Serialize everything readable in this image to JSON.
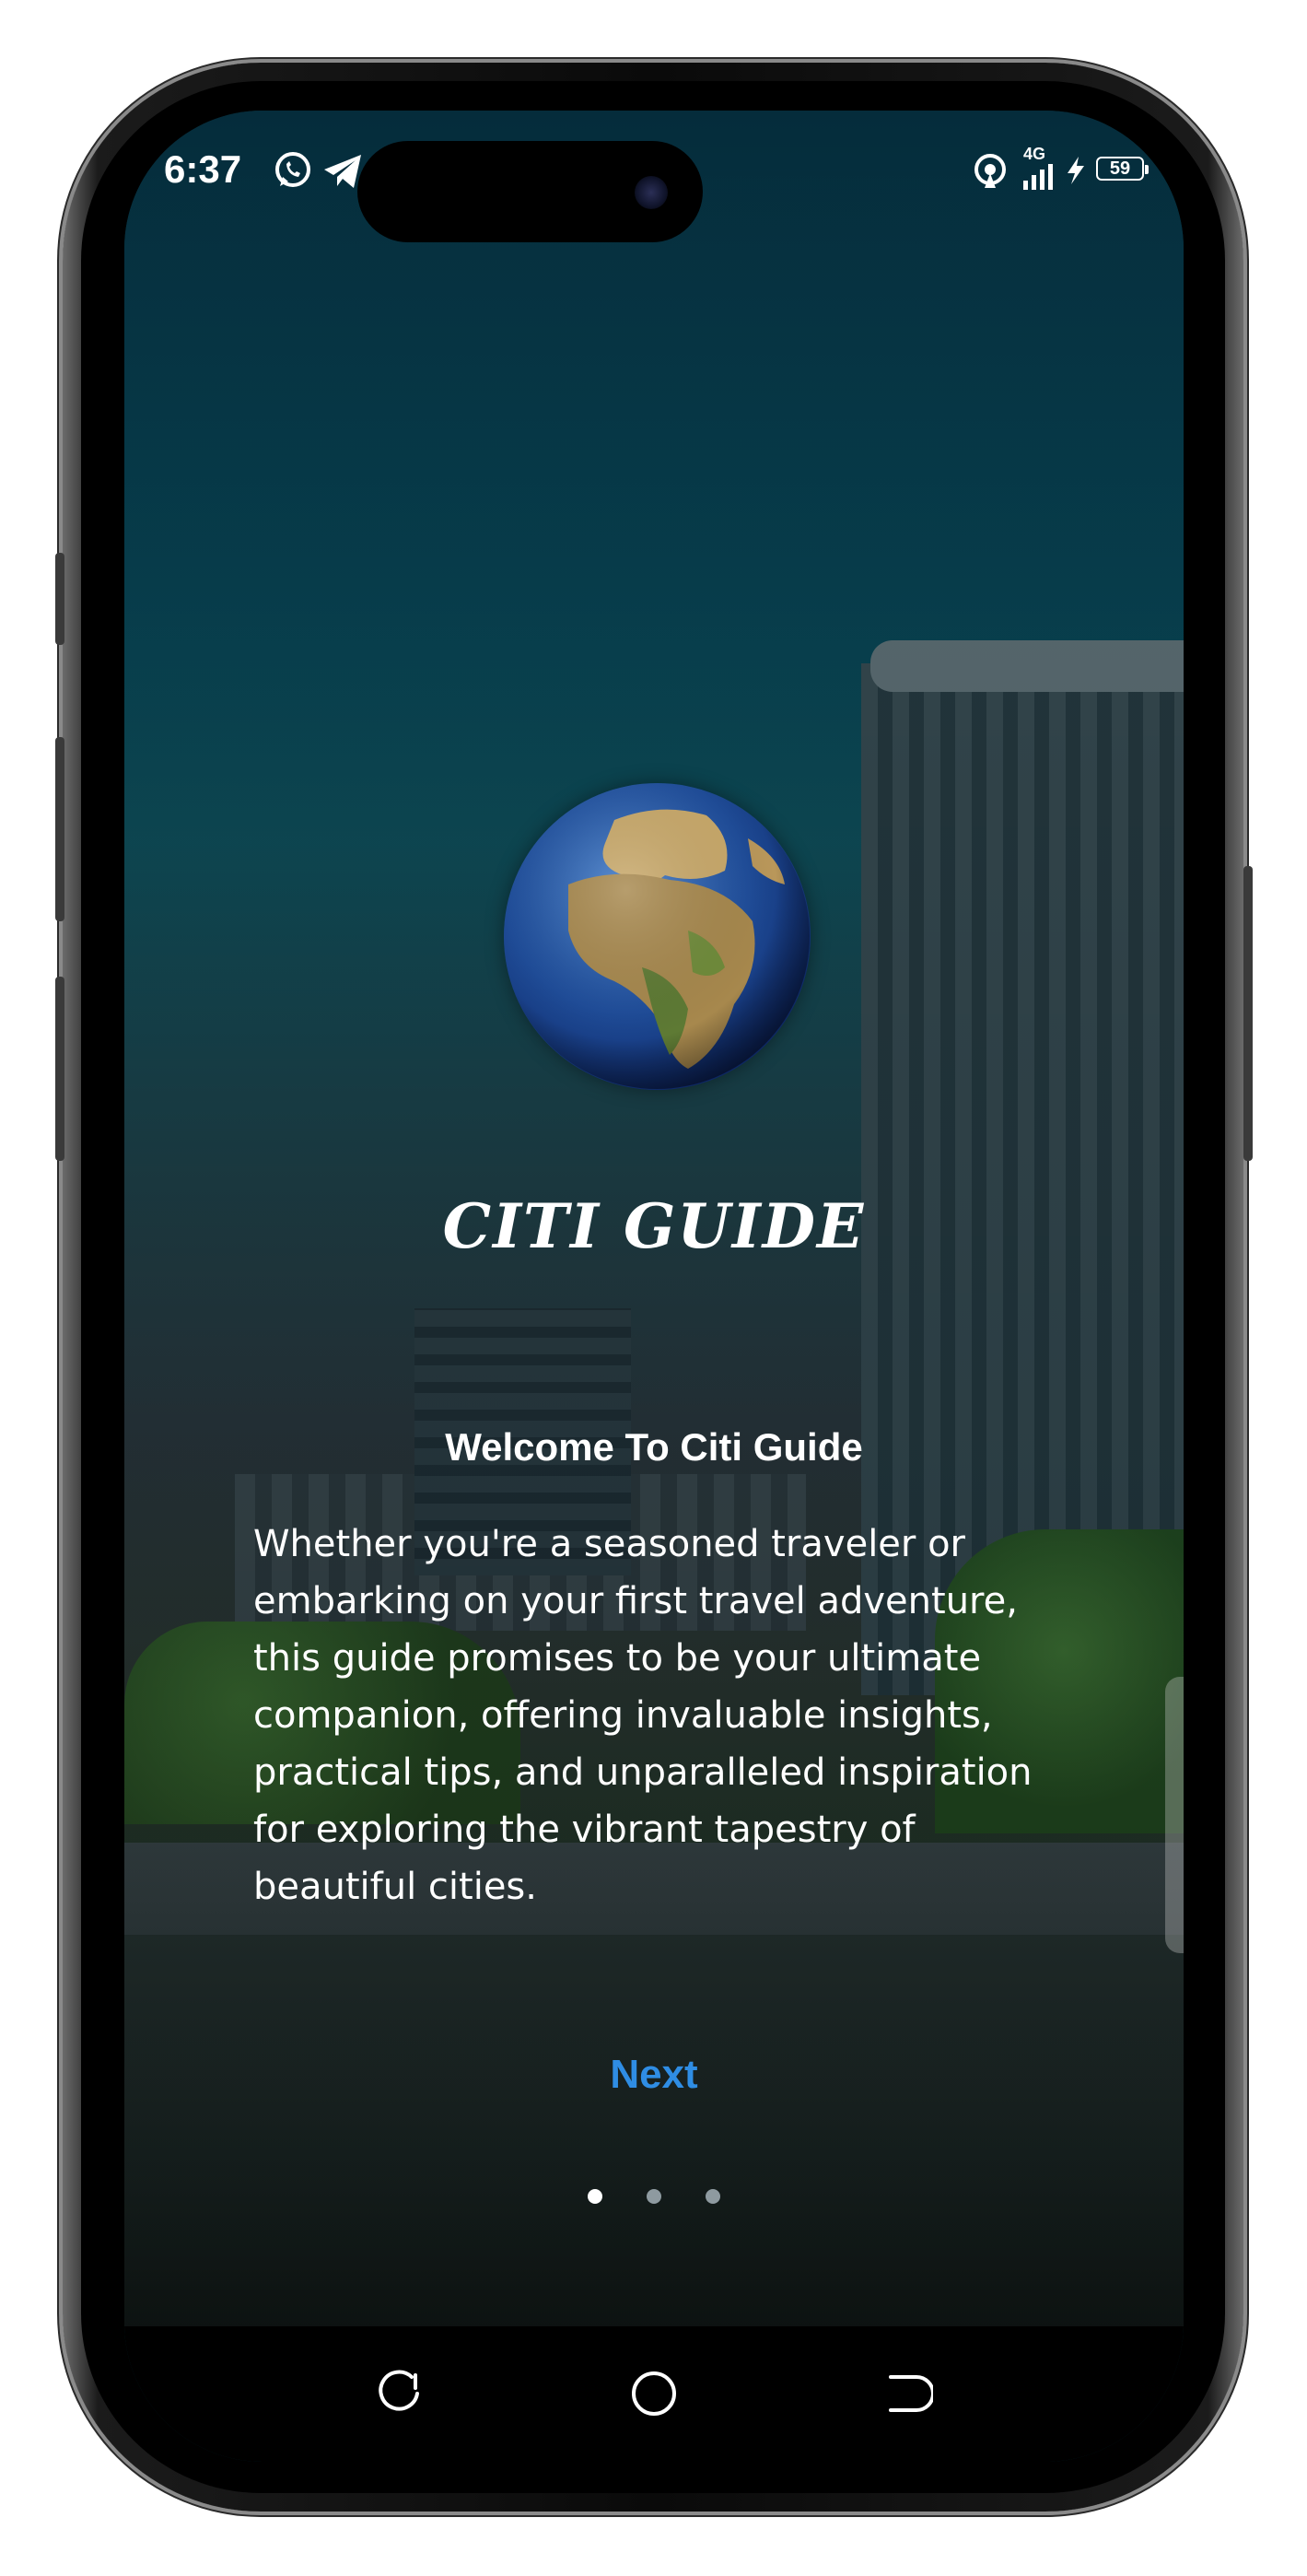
{
  "status_bar": {
    "time": "6:37",
    "network": "4G",
    "battery": "59",
    "icons": [
      "whatsapp-icon",
      "telegram-icon",
      "hotspot-icon",
      "signal-icon",
      "charging-icon",
      "battery-icon"
    ]
  },
  "app": {
    "logo_text": "CITI GUIDE",
    "welcome_title": "Welcome To Citi Guide",
    "description": "Whether you're a seasoned traveler or embarking on your first travel adventure, this guide promises to be your ultimate companion, offering invaluable insights, practical tips, and unparalleled inspiration for exploring the vibrant tapestry of beautiful cities.",
    "next_label": "Next",
    "page_indicator": {
      "count": 3,
      "active_index": 0
    }
  },
  "nav_bar": {
    "items": [
      "recents-icon",
      "home-icon",
      "back-icon"
    ]
  },
  "colors": {
    "accent": "#2f8de4",
    "background_top": "#052c3b"
  }
}
